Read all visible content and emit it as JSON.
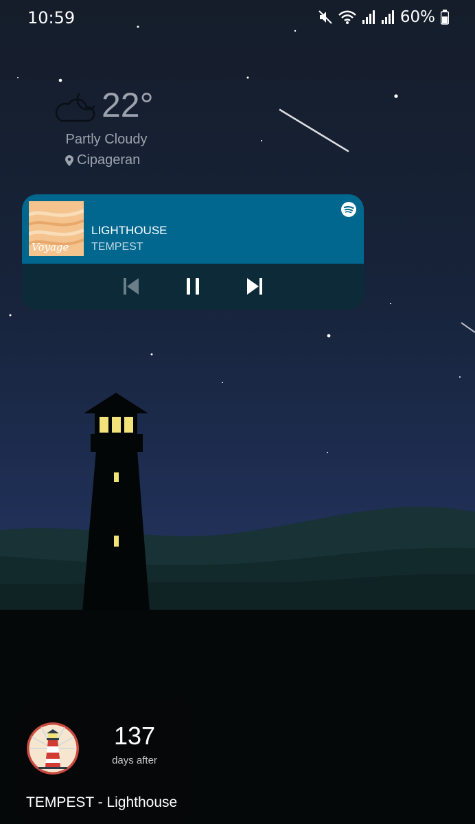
{
  "status_bar": {
    "time": "10:59",
    "battery_percent": "60%",
    "icons": [
      "mute-icon",
      "wifi-icon",
      "signal-icon",
      "signal-icon",
      "battery-icon"
    ]
  },
  "weather": {
    "temperature": "22°",
    "condition": "Partly Cloudy",
    "location": "Cipageran",
    "icon": "partly-cloudy-night-icon"
  },
  "media_player": {
    "track_title": "LIGHTHOUSE",
    "artist": "TEMPEST",
    "album_art_text": "Voyage",
    "app_icon": "spotify-icon",
    "controls": [
      "previous-icon",
      "pause-icon",
      "next-icon"
    ],
    "colors": {
      "header": "#02678e",
      "controls_bg": "#0c2a38"
    }
  },
  "day_counter": {
    "count": "137",
    "label": "days after",
    "title": "TEMPEST - Lighthouse",
    "icon": "lighthouse-icon"
  },
  "wallpaper": {
    "theme": "night-lighthouse",
    "window_light_color": "#f2e27a"
  }
}
